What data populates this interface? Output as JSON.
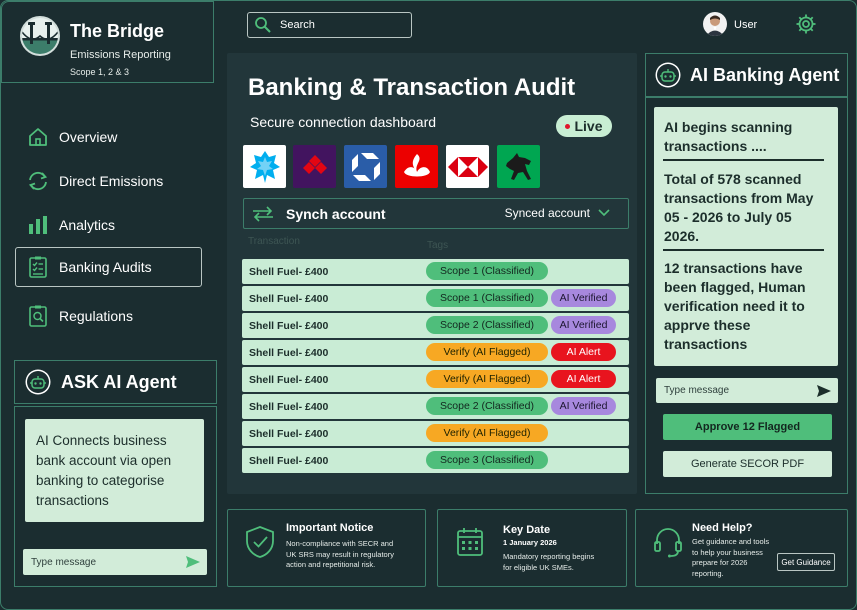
{
  "app": {
    "title": "The Bridge",
    "subtitle": "Emissions Reporting",
    "scope": "Scope 1, 2 & 3"
  },
  "topbar": {
    "search_placeholder": "Search",
    "user_label": "User"
  },
  "sidebar": {
    "items": [
      {
        "label": "Overview",
        "icon": "home-icon",
        "active": false
      },
      {
        "label": "Direct Emissions",
        "icon": "refresh-icon",
        "active": false
      },
      {
        "label": "Analytics",
        "icon": "bar-chart-icon",
        "active": false
      },
      {
        "label": "Banking Audits",
        "icon": "checklist-icon",
        "active": true
      },
      {
        "label": "Regulations",
        "icon": "document-search-icon",
        "active": false
      }
    ]
  },
  "ask_agent": {
    "title": "ASK AI Agent",
    "message": "AI Connects business bank account via open banking to categorise transactions",
    "input_placeholder": "Type message"
  },
  "main": {
    "title": "Banking & Transaction Audit",
    "subtitle": "Secure connection dashboard",
    "live_label": "Live",
    "banks": [
      {
        "name": "Barclays",
        "bg": "#ffffff"
      },
      {
        "name": "NatWest",
        "bg": "#42145f"
      },
      {
        "name": "Chase",
        "bg": "#2a5da8"
      },
      {
        "name": "Santander",
        "bg": "#ec0000"
      },
      {
        "name": "HSBC",
        "bg": "#ffffff"
      },
      {
        "name": "Lloyds",
        "bg": "#00a651"
      }
    ],
    "synch": {
      "title": "Synch account",
      "selected": "Synced account"
    },
    "columns": [
      "Transaction",
      "Tags"
    ],
    "transactions": [
      {
        "name": "Shell Fuel- £400",
        "status": "Scope 1 (Classified)",
        "status_kind": "green",
        "flag": "",
        "flag_kind": ""
      },
      {
        "name": "Shell Fuel- £400",
        "status": "Scope 1 (Classified)",
        "status_kind": "green",
        "flag": "AI Verified",
        "flag_kind": "purple"
      },
      {
        "name": "Shell Fuel- £400",
        "status": "Scope 2 (Classified)",
        "status_kind": "green",
        "flag": "AI Verified",
        "flag_kind": "purple"
      },
      {
        "name": "Shell Fuel- £400",
        "status": "Verify (AI Flagged)",
        "status_kind": "orange",
        "flag": "AI Alert",
        "flag_kind": "red"
      },
      {
        "name": "Shell Fuel- £400",
        "status": "Verify (AI Flagged)",
        "status_kind": "orange",
        "flag": "AI Alert",
        "flag_kind": "red"
      },
      {
        "name": "Shell Fuel- £400",
        "status": "Scope 2 (Classified)",
        "status_kind": "green",
        "flag": "AI Verified",
        "flag_kind": "purple"
      },
      {
        "name": "Shell Fuel- £400",
        "status": "Verify (AI Flagged)",
        "status_kind": "orange",
        "flag": "",
        "flag_kind": ""
      },
      {
        "name": "Shell Fuel- £400",
        "status": "Scope 3 (Classified)",
        "status_kind": "green",
        "flag": "",
        "flag_kind": ""
      }
    ]
  },
  "agent": {
    "title": "AI  Banking Agent",
    "messages": [
      "AI begins scanning transactions ....",
      "Total of 578 scanned transactions from May 05 - 2026 to July 05 2026.",
      "12 transactions have been flagged,  Human verification need it to apprve these transactions"
    ],
    "input_placeholder": "Type message",
    "approve_label": "Approve 12 Flagged",
    "pdf_label": "Generate SECOR PDF"
  },
  "cards": {
    "notice": {
      "title": "Important  Notice",
      "lines": [
        "Non-compliance with SECR and",
        "UK SRS may result in regulatory",
        "action and repetitional risk."
      ]
    },
    "date": {
      "title": "Key Date",
      "date": "1 January 2026",
      "lines": [
        "Mandatory reporting begins",
        "for eligible UK SMEs."
      ]
    },
    "help": {
      "title": "Need Help?",
      "lines": [
        "Get guidance and tools",
        "to help your business",
        "prepare for 2026",
        "reporting."
      ],
      "button": "Get Guidance"
    }
  },
  "colors": {
    "background": "#1b2d30",
    "panel": "#22363a",
    "border": "#3c7d6a",
    "mint": "#d2ecd9",
    "green": "#4fbe7b",
    "orange": "#f7a823",
    "purple": "#a788de",
    "red": "#e8141e"
  }
}
